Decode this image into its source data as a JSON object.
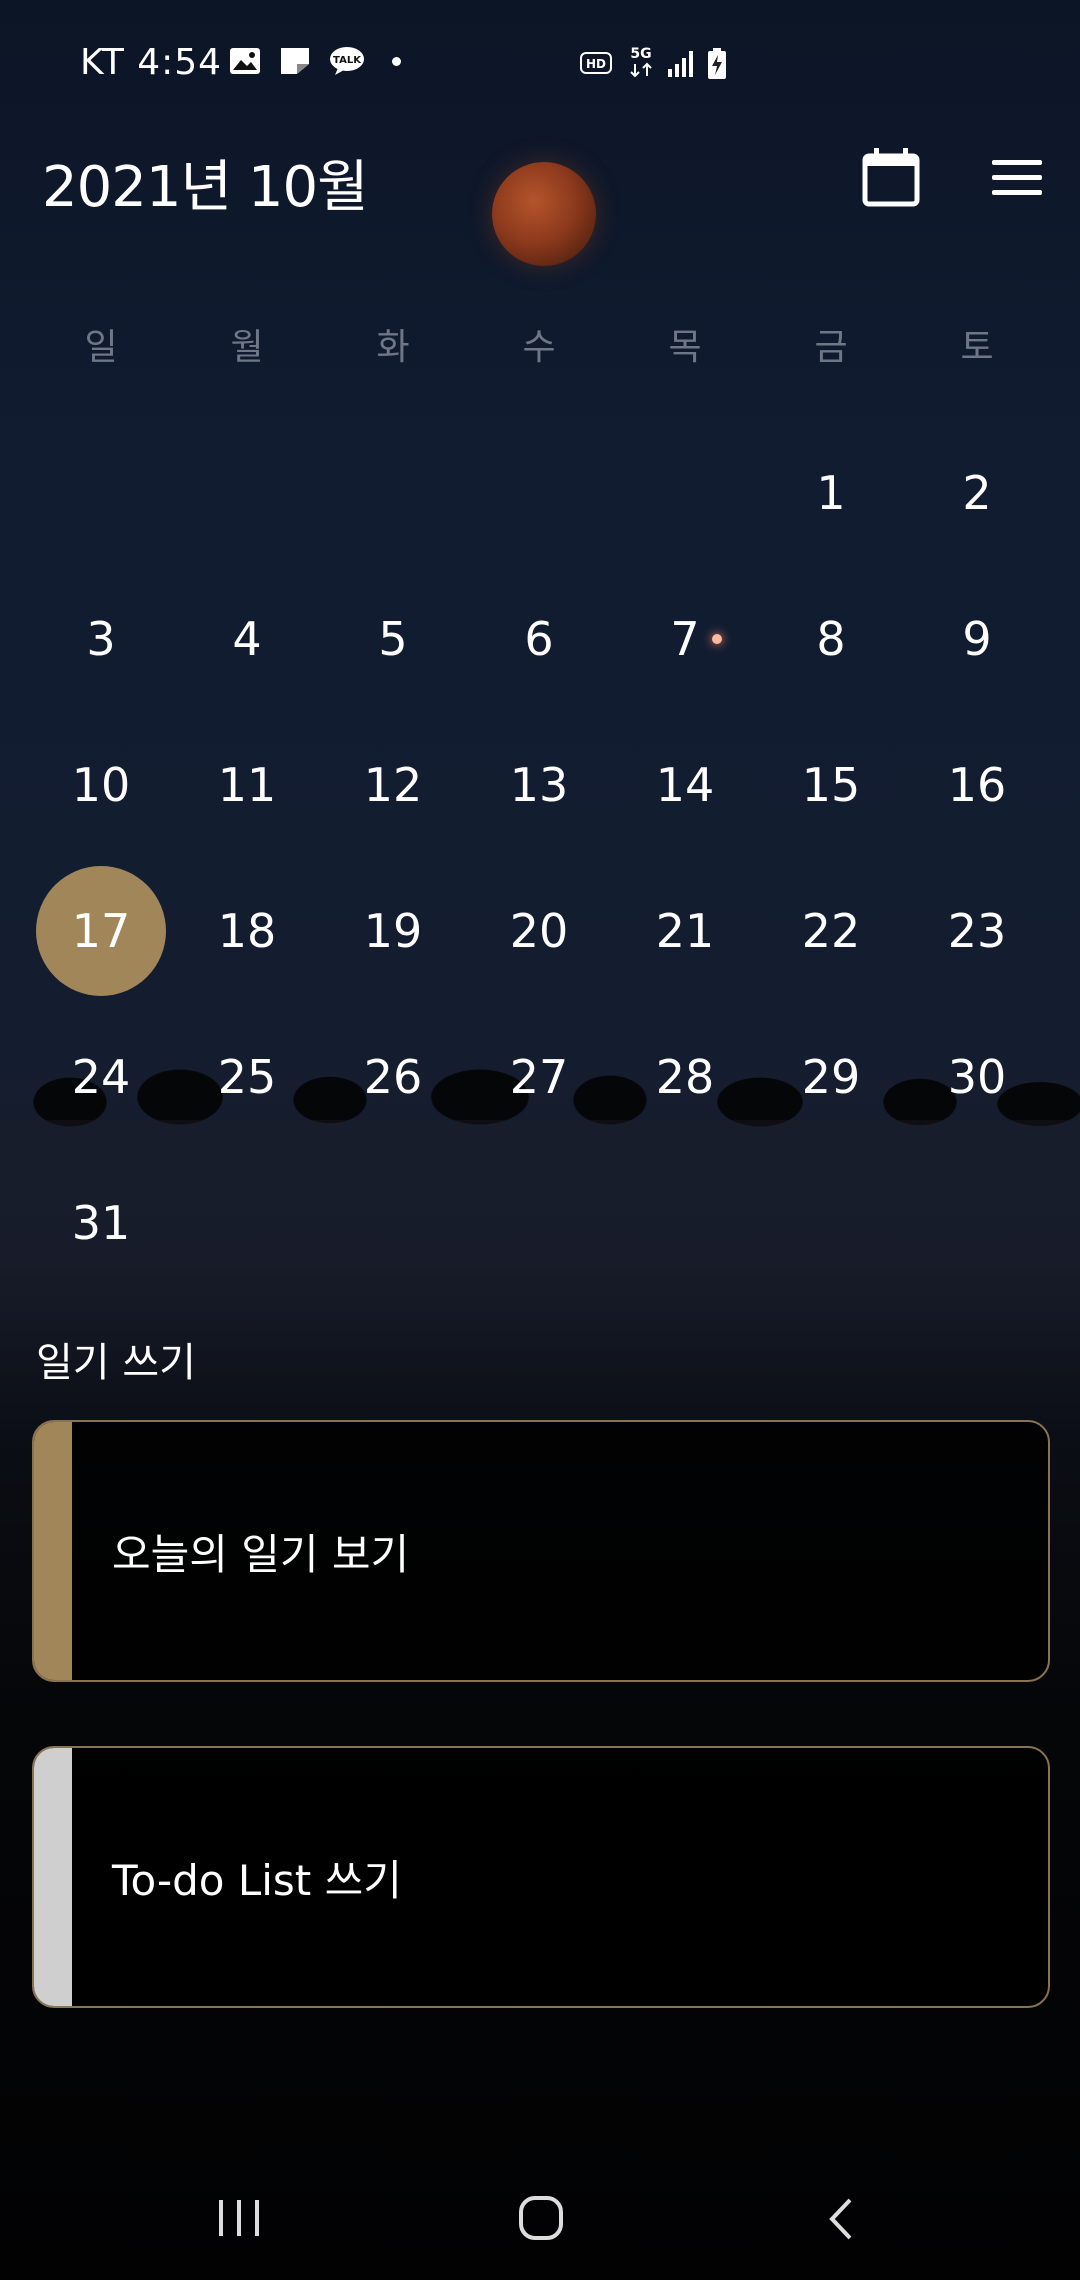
{
  "status_bar": {
    "carrier_time": "KT 4:54",
    "left_icons": [
      "image-icon",
      "sticky-note-icon",
      "kakaotalk-icon"
    ],
    "kakao_text": "TALK",
    "right_icons": [
      "hd-voice-icon",
      "5g-icon",
      "signal-icon",
      "battery-charging-icon"
    ],
    "hd_text": "HD",
    "net_text": "5G"
  },
  "header": {
    "title": "2021년 10월",
    "calendar_icon": "calendar-icon",
    "menu_icon": "menu-icon"
  },
  "calendar": {
    "weekdays": [
      "일",
      "월",
      "화",
      "수",
      "목",
      "금",
      "토"
    ],
    "leading_blanks": 5,
    "days": [
      "1",
      "2",
      "3",
      "4",
      "5",
      "6",
      "7",
      "8",
      "9",
      "10",
      "11",
      "12",
      "13",
      "14",
      "15",
      "16",
      "17",
      "18",
      "19",
      "20",
      "21",
      "22",
      "23",
      "24",
      "25",
      "26",
      "27",
      "28",
      "29",
      "30",
      "31"
    ],
    "selected_day": "17",
    "selected_color": "#a08659"
  },
  "diary": {
    "section_label": "일기 쓰기",
    "cards": [
      {
        "label": "오늘의 일기 보기",
        "accent": "#a08659"
      },
      {
        "label": "To-do List 쓰기",
        "accent": "#cfcfcf"
      }
    ]
  },
  "nav": {
    "icons": [
      "recent-apps-icon",
      "home-icon",
      "back-icon"
    ]
  }
}
